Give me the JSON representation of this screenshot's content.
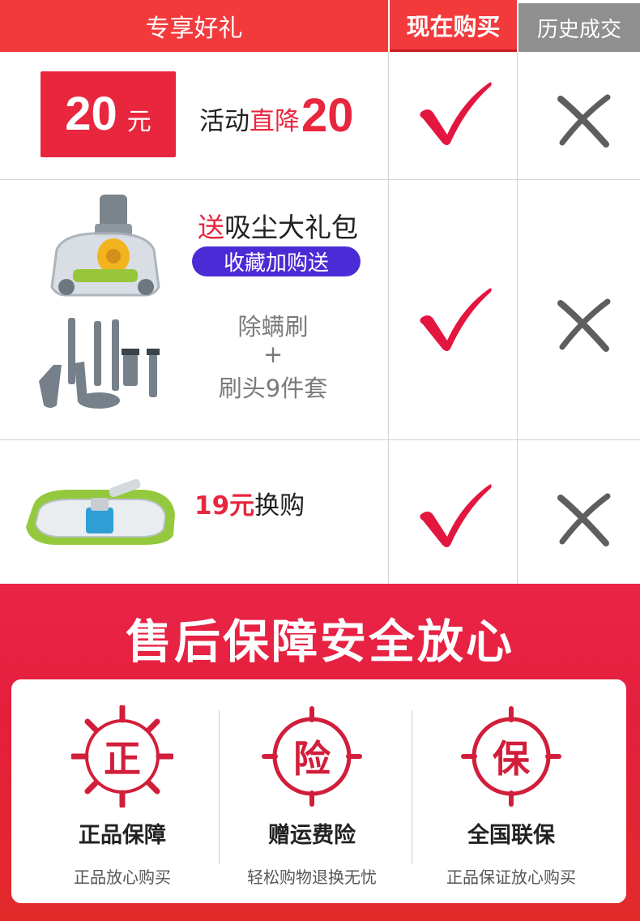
{
  "comparison": {
    "headers": {
      "gift": "专享好礼",
      "now": "现在购买",
      "history": "历史成交"
    },
    "row1": {
      "coupon_amount": "20",
      "coupon_unit": "元",
      "promo_prefix": "活动",
      "promo_highlight": "直降",
      "promo_number": "20"
    },
    "row2": {
      "title_red": "送",
      "title_rest": "吸尘大礼包",
      "button_label": "收藏加购送",
      "items": [
        "除螨刷",
        "+",
        "刷头9件套"
      ]
    },
    "row3": {
      "price": "19元",
      "label": "换购"
    }
  },
  "after_sales": {
    "title": "售后保障安全放心",
    "items": [
      {
        "seal": "正",
        "title": "正品保障",
        "subtitle": "正品放心购买"
      },
      {
        "seal": "险",
        "title": "赠运费险",
        "subtitle": "轻松购物退换无忧"
      },
      {
        "seal": "保",
        "title": "全国联保",
        "subtitle": "正品保证放心购买"
      }
    ]
  },
  "colors": {
    "brand_red": "#f23a3c",
    "check_red": "#e3163f",
    "cross_gray": "#5e5e5e",
    "history_gray": "#8f8f8f",
    "button_purple": "#4b2bd6"
  },
  "icons": {
    "now_column": "red-check-mark-icon",
    "history_column": "gray-cross-mark-icon",
    "seal": "circular-stamp-icon"
  }
}
